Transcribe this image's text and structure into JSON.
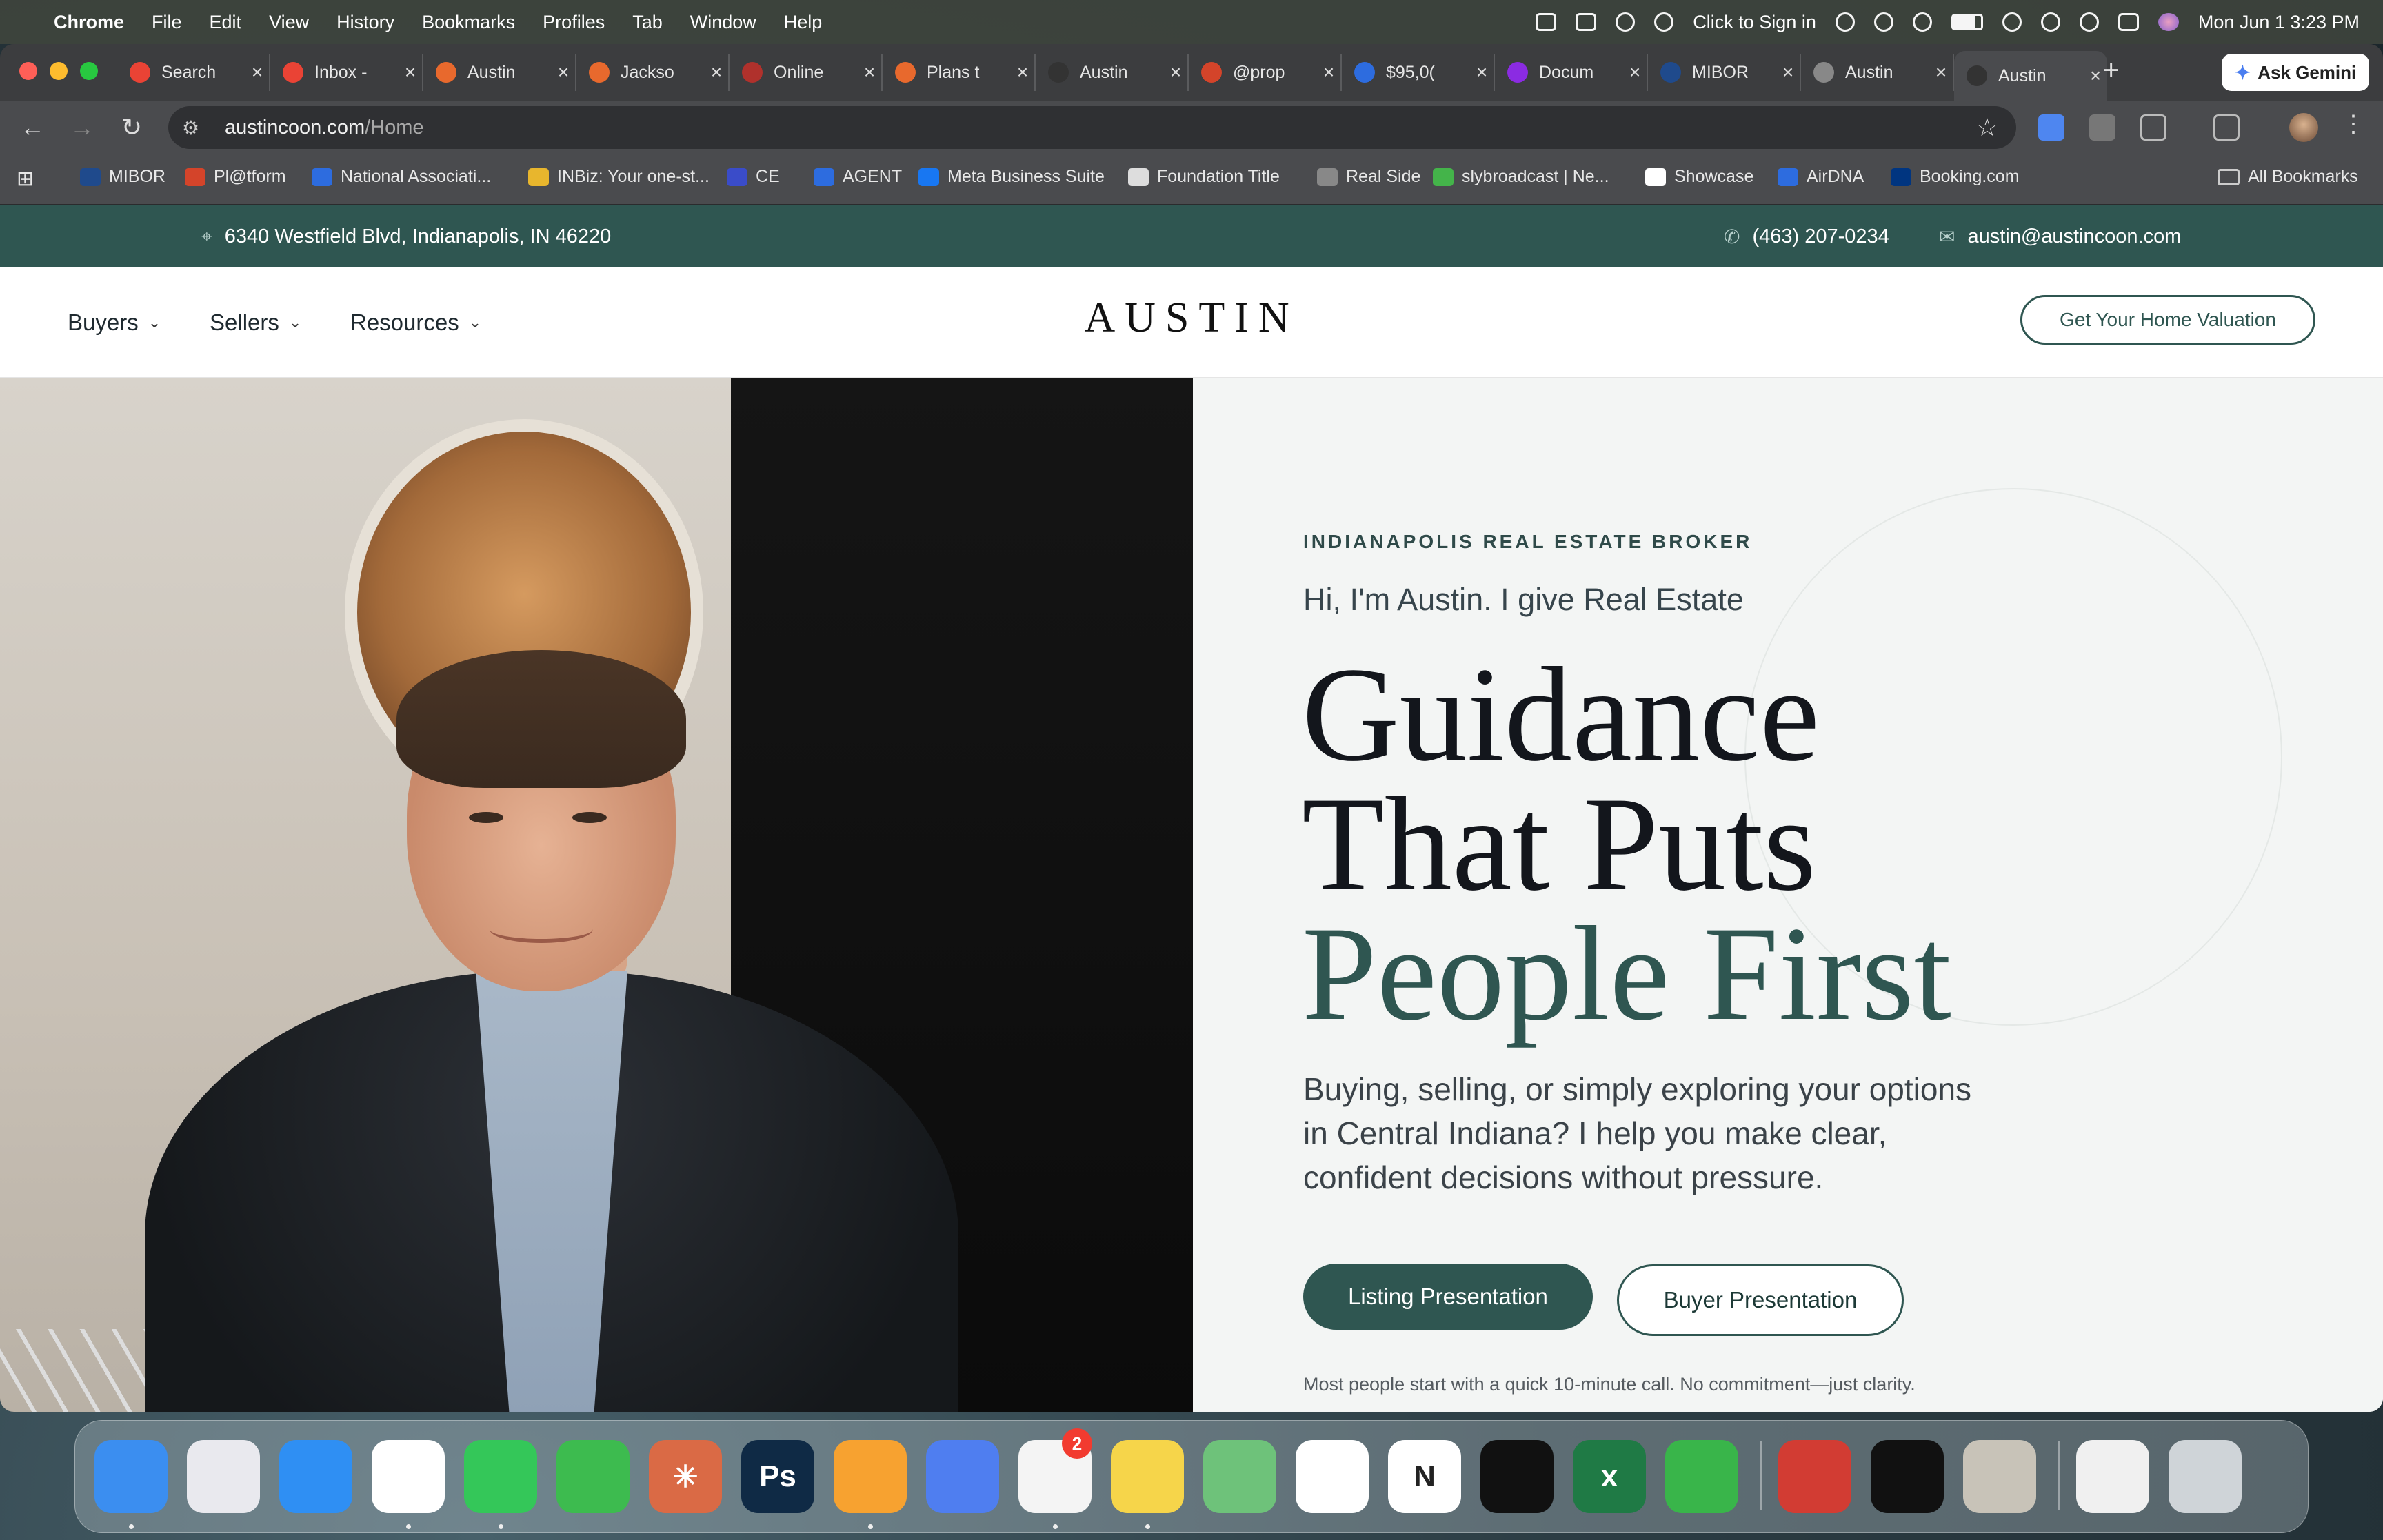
{
  "menubar": {
    "app_name": "Chrome",
    "menus": [
      "File",
      "Edit",
      "View",
      "History",
      "Bookmarks",
      "Profiles",
      "Tab",
      "Window",
      "Help"
    ],
    "sign_in": "Click to Sign in",
    "datetime": "Mon Jun 1  3:23 PM"
  },
  "tabs": [
    {
      "title": "Search",
      "icon": "gmail-icon",
      "color": "#ea4335"
    },
    {
      "title": "Inbox -",
      "icon": "gmail-icon",
      "color": "#ea4335"
    },
    {
      "title": "Austin",
      "icon": "claude-icon",
      "color": "#e8692d"
    },
    {
      "title": "Jackso",
      "icon": "claude-icon",
      "color": "#e8692d"
    },
    {
      "title": "Online",
      "icon": "record-icon",
      "color": "#b0312c"
    },
    {
      "title": "Plans t",
      "icon": "claude-icon",
      "color": "#e8692d"
    },
    {
      "title": "Austin",
      "icon": "site-icon",
      "color": "#333333"
    },
    {
      "title": "@prop",
      "icon": "at-icon",
      "color": "#d4442a"
    },
    {
      "title": "$95,0(",
      "icon": "doc-icon",
      "color": "#2d6cdf"
    },
    {
      "title": "Docum",
      "icon": "docusign-icon",
      "color": "#8b2be2"
    },
    {
      "title": "MIBOR",
      "icon": "mibor-icon",
      "color": "#1f4a8c"
    },
    {
      "title": "Austin",
      "icon": "infinity-icon",
      "color": "#888888"
    },
    {
      "title": "Austin",
      "icon": "site-icon",
      "color": "#333333"
    }
  ],
  "gemini_label": "Ask Gemini",
  "address": {
    "domain": "austincoon.com",
    "path": "/Home"
  },
  "bookmarks": [
    {
      "label": "MIBOR",
      "color": "#1f4a8c"
    },
    {
      "label": "Pl@tform",
      "color": "#d4442a"
    },
    {
      "label": "National Associati...",
      "color": "#2d6cdf"
    },
    {
      "label": "INBiz: Your one-st...",
      "color": "#e8b62d"
    },
    {
      "label": "CE",
      "color": "#3a4cc9"
    },
    {
      "label": "AGENT",
      "color": "#2d6cdf"
    },
    {
      "label": "Meta Business Suite",
      "color": "#1877f2"
    },
    {
      "label": "Foundation Title",
      "color": "#dddddd"
    },
    {
      "label": "Real Side",
      "color": "#888888"
    },
    {
      "label": "slybroadcast | Ne...",
      "color": "#44b44a"
    },
    {
      "label": "Showcase",
      "color": "#ffffff"
    },
    {
      "label": "AirDNA",
      "color": "#2d6cdf"
    },
    {
      "label": "Booking.com",
      "color": "#003580"
    }
  ],
  "all_bookmarks": "All Bookmarks",
  "site": {
    "address": "6340 Westfield Blvd, Indianapolis, IN 46220",
    "phone": "(463) 207-0234",
    "email": "austin@austincoon.com",
    "nav": [
      "Buyers",
      "Sellers",
      "Resources"
    ],
    "logo": "AUSTIN",
    "valuation_cta": "Get Your Home Valuation",
    "eyebrow": "INDIANAPOLIS REAL ESTATE BROKER",
    "subhead": "Hi, I'm Austin. I give Real Estate",
    "headline_1": "Guidance",
    "headline_2": "That Puts",
    "headline_3": "People First",
    "description": "Buying, selling, or simply exploring your options in Central Indiana? I help you make clear, confident decisions without pressure.",
    "listing_button": "Listing Presentation",
    "buyer_button": "Buyer Presentation",
    "note": "Most people start with a quick 10-minute call. No commitment—just clarity."
  },
  "dock": {
    "apps": [
      {
        "name": "finder-icon",
        "color": "#3b8ef0",
        "glyph": ""
      },
      {
        "name": "launchpad-icon",
        "color": "#e9e9ee",
        "glyph": ""
      },
      {
        "name": "safari-icon",
        "color": "#2f8ff3",
        "glyph": ""
      },
      {
        "name": "chrome-icon",
        "color": "#ffffff",
        "glyph": ""
      },
      {
        "name": "messages-icon",
        "color": "#34c759",
        "glyph": ""
      },
      {
        "name": "numbers-icon",
        "color": "#3dbb4f",
        "glyph": ""
      },
      {
        "name": "claude-app-icon",
        "color": "#da6a45",
        "glyph": "✳"
      },
      {
        "name": "photoshop-icon",
        "color": "#0f2a45",
        "glyph": "Ps"
      },
      {
        "name": "pages-icon",
        "color": "#f7a230",
        "glyph": ""
      },
      {
        "name": "ai-app-icon",
        "color": "#4f7ef0",
        "glyph": ""
      },
      {
        "name": "reminders-icon",
        "color": "#f4f4f4",
        "glyph": ""
      },
      {
        "name": "notes-icon",
        "color": "#f6d54a",
        "glyph": ""
      },
      {
        "name": "maps-icon",
        "color": "#6ec27a",
        "glyph": ""
      },
      {
        "name": "slack-icon",
        "color": "#ffffff",
        "glyph": ""
      },
      {
        "name": "notion-icon",
        "color": "#ffffff",
        "glyph": "N"
      },
      {
        "name": "spotify-icon",
        "color": "#111111",
        "glyph": ""
      },
      {
        "name": "excel-icon",
        "color": "#1f7a45",
        "glyph": "x"
      },
      {
        "name": "find-my-icon",
        "color": "#39b54a",
        "glyph": ""
      },
      {
        "name": "photo-booth-icon",
        "color": "#d23c33",
        "glyph": ""
      },
      {
        "name": "teleprompter-icon",
        "color": "#111111",
        "glyph": ""
      },
      {
        "name": "contacts-icon",
        "color": "#c8c3b8",
        "glyph": ""
      },
      {
        "name": "document-icon",
        "color": "#f0f0f0",
        "glyph": ""
      },
      {
        "name": "trash-icon",
        "color": "#cfd4d8",
        "glyph": ""
      }
    ],
    "reminders_badge": "2"
  }
}
